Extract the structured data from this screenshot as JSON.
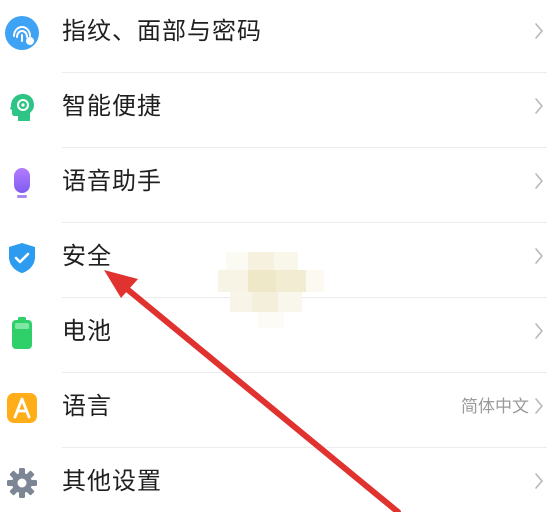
{
  "settings": {
    "items": [
      {
        "label": "指纹、面部与密码",
        "value": "",
        "icon": "fingerprint-face-icon",
        "color": "#3ea2f5"
      },
      {
        "label": "智能便捷",
        "value": "",
        "icon": "smart-head-icon",
        "color": "#2ec486"
      },
      {
        "label": "语音助手",
        "value": "",
        "icon": "voice-assistant-icon",
        "color": "#9b6cf0"
      },
      {
        "label": "安全",
        "value": "",
        "icon": "shield-icon",
        "color": "#2d9bf0"
      },
      {
        "label": "电池",
        "value": "",
        "icon": "battery-icon",
        "color": "#2fcf6a"
      },
      {
        "label": "语言",
        "value": "简体中文",
        "icon": "language-icon",
        "color": "#ffae1a"
      },
      {
        "label": "其他设置",
        "value": "",
        "icon": "gear-icon",
        "color": "#7c8694"
      }
    ]
  },
  "annotation": {
    "arrow_color": "#e0322f"
  }
}
